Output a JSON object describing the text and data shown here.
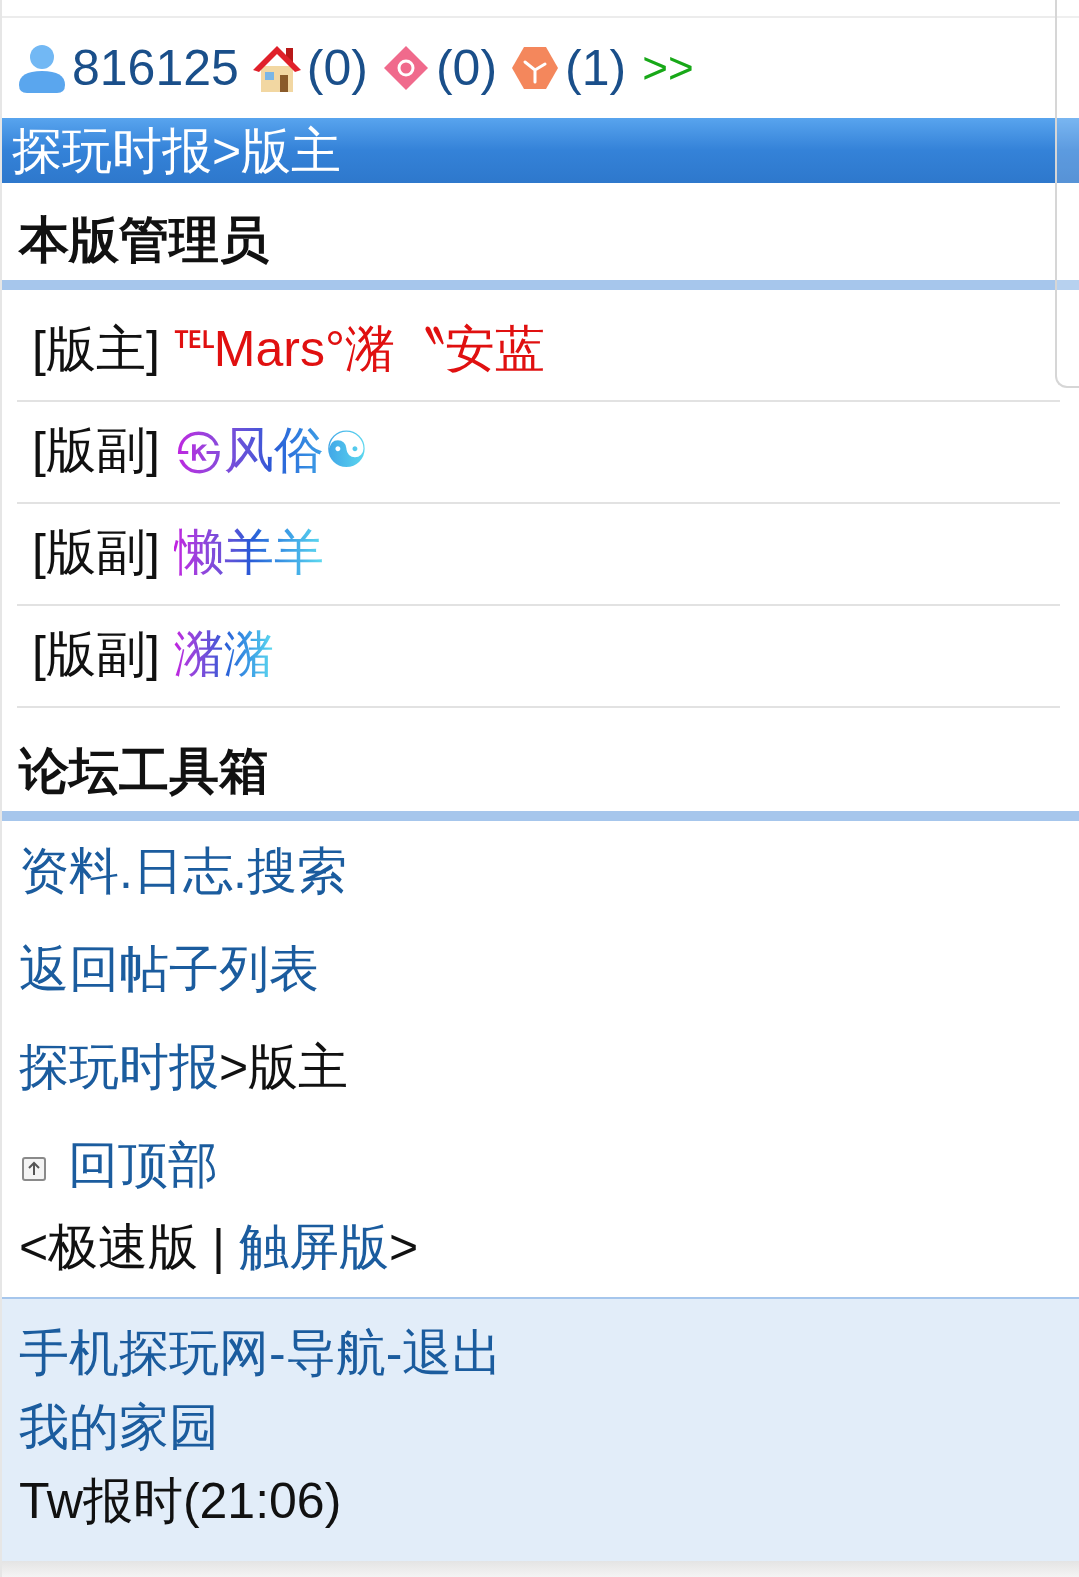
{
  "user_bar": {
    "user_id": "816125",
    "counters": [
      {
        "count": "(0)"
      },
      {
        "count": "(0)"
      },
      {
        "count": "(1)"
      }
    ],
    "more_link": ">>"
  },
  "title_bar": {
    "title": "探玩时报>版主"
  },
  "moderators": {
    "heading": "本版管理员",
    "items": [
      {
        "role": "[版主]",
        "name": "℡Mars°潴〝安蓝",
        "kind": "solid",
        "color": "#e01010"
      },
      {
        "role": "[版副]",
        "name": "㉿风俗☯",
        "kind": "gradient"
      },
      {
        "role": "[版副]",
        "name": "懒羊羊",
        "kind": "gradient"
      },
      {
        "role": "[版副]",
        "name": "潴潴",
        "kind": "gradient"
      }
    ]
  },
  "toolbox": {
    "heading": "论坛工具箱",
    "lines": [
      {
        "kind": "text",
        "parts": [
          {
            "text": "资料.日志.搜索",
            "link": true
          }
        ]
      },
      {
        "kind": "text",
        "parts": [
          {
            "text": "返回帖子列表",
            "link": true
          }
        ]
      },
      {
        "kind": "text",
        "parts": [
          {
            "text": "探玩时报",
            "link": true
          },
          {
            "text": ">版主",
            "link": false
          }
        ]
      },
      {
        "kind": "back_to_top",
        "parts": [
          {
            "text": "回顶部",
            "link": true
          }
        ]
      },
      {
        "kind": "text",
        "parts": [
          {
            "text": "<极速版 | ",
            "link": false
          },
          {
            "text": "触屏版",
            "link": true
          },
          {
            "text": ">",
            "link": false
          }
        ]
      }
    ]
  },
  "footer": {
    "lines": [
      {
        "parts": [
          {
            "text": "手机探玩网-导航-退出",
            "link": true
          }
        ]
      },
      {
        "parts": [
          {
            "text": "我的家园",
            "link": true
          }
        ]
      },
      {
        "parts": [
          {
            "text": "Tw报时(21:06)",
            "link": false
          }
        ]
      }
    ]
  }
}
